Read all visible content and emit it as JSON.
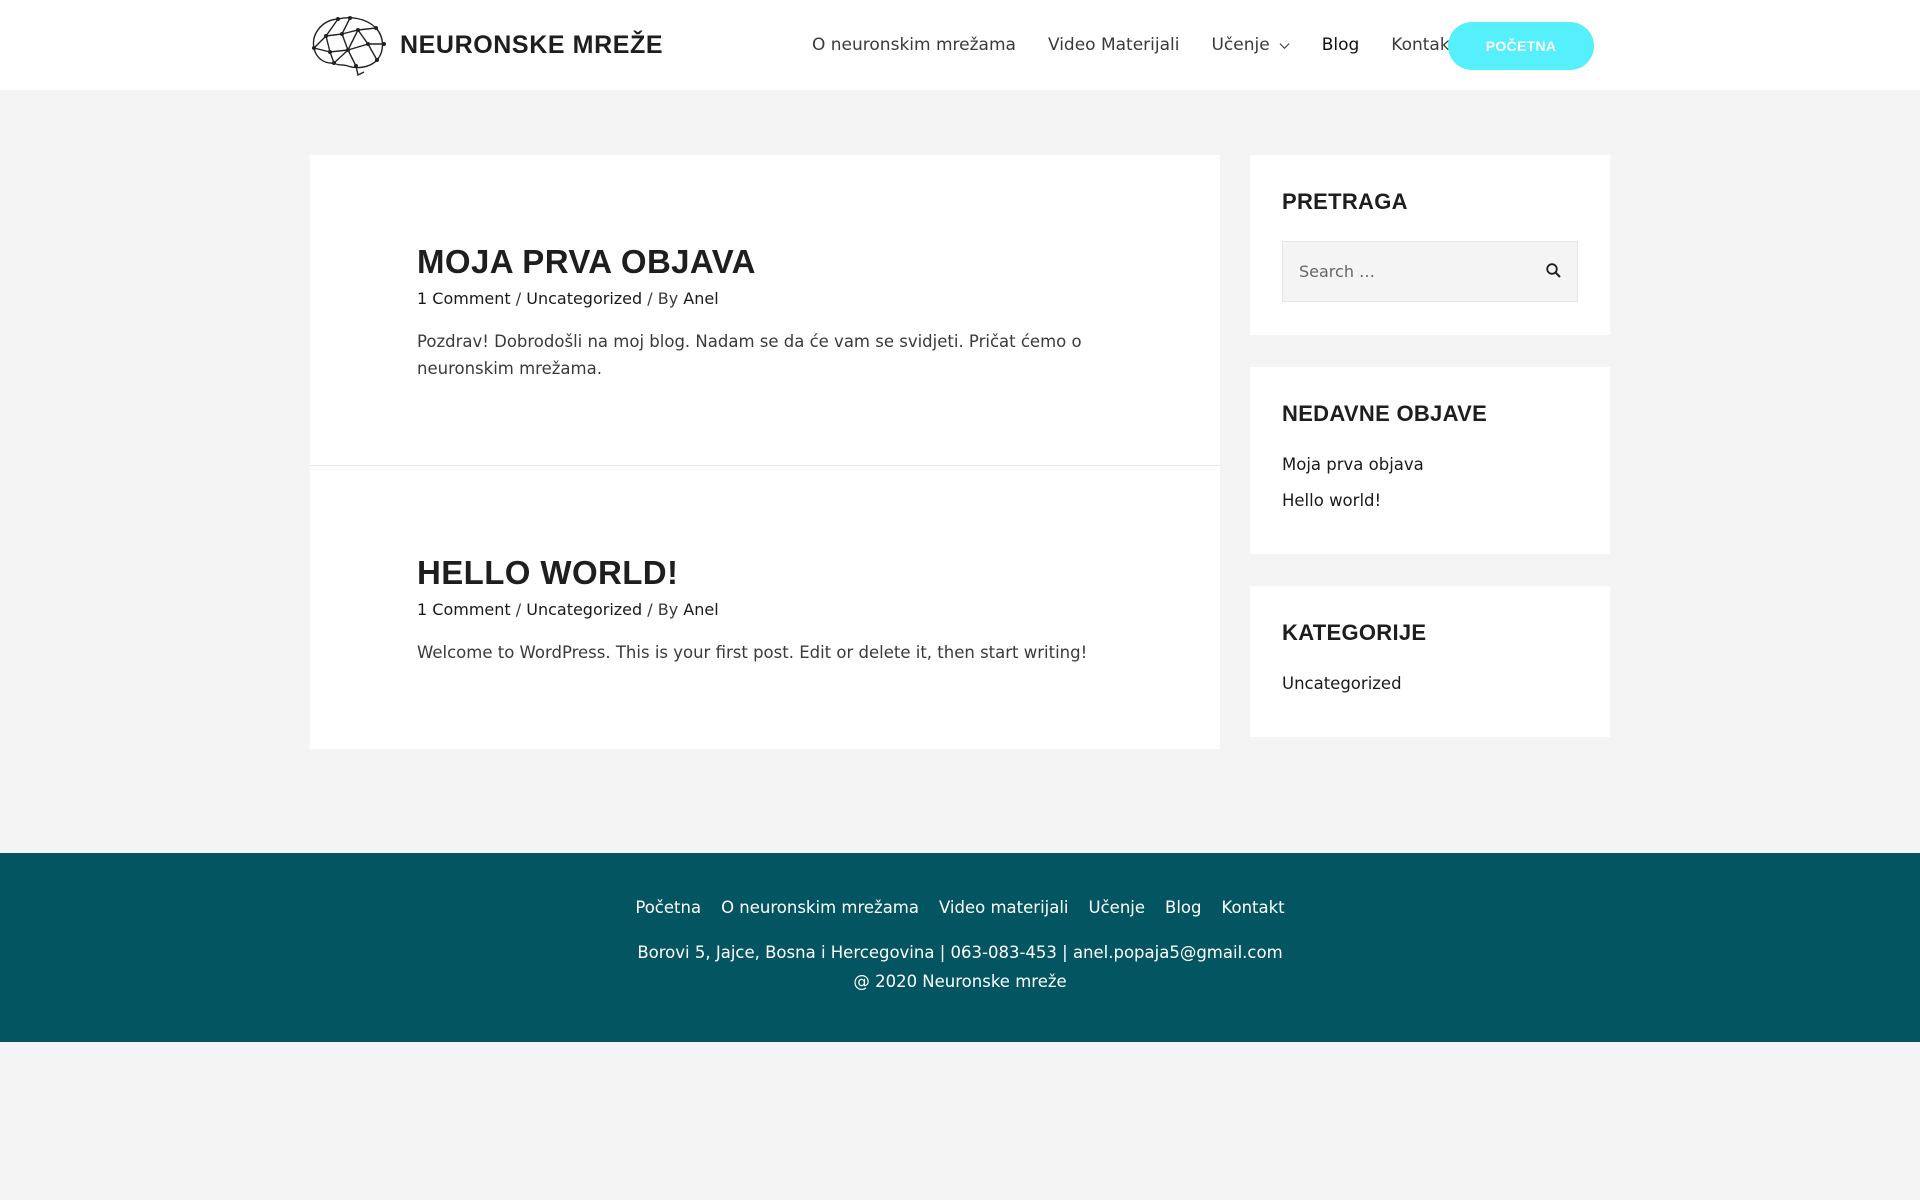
{
  "header": {
    "site_title": "NEURONSKE MREŽE",
    "logo_icon": "brain-network-icon",
    "nav": [
      {
        "label": "O neuronskim mrežama"
      },
      {
        "label": "Video Materijali"
      },
      {
        "label": "Učenje",
        "has_dropdown": true
      },
      {
        "label": "Blog",
        "current": true
      },
      {
        "label": "Kontakt"
      }
    ],
    "cta_label": "POČETNA"
  },
  "posts": [
    {
      "title": "MOJA PRVA OBJAVA",
      "comments": "1 Comment",
      "category": "Uncategorized",
      "by_prefix": "/ By",
      "author": "Anel",
      "excerpt": "Pozdrav! Dobrodošli na moj blog. Nadam se da će vam se svidjeti. Pričat ćemo o neuronskim mrežama."
    },
    {
      "title": "HELLO WORLD!",
      "comments": "1 Comment",
      "category": "Uncategorized",
      "by_prefix": "/ By",
      "author": "Anel",
      "excerpt": "Welcome to WordPress. This is your first post. Edit or delete it, then start writing!"
    }
  ],
  "meta_separator": "/",
  "sidebar": {
    "search": {
      "title": "PRETRAGA",
      "placeholder": "Search …"
    },
    "recent": {
      "title": "NEDAVNE OBJAVE",
      "items": [
        "Moja prva objava",
        "Hello world!"
      ]
    },
    "categories": {
      "title": "KATEGORIJE",
      "items": [
        "Uncategorized"
      ]
    }
  },
  "footer": {
    "nav": [
      "Početna",
      "O neuronskim mrežama",
      "Video materijali",
      "Učenje",
      "Blog",
      "Kontakt"
    ],
    "address": "Borovi 5, Jajce, Bosna i Hercegovina | 063-083-453 | anel.popaja5@gmail.com",
    "copyright": "@ 2020 Neuronske mreže"
  },
  "colors": {
    "accent_button": "#55f0fb",
    "footer_bg": "#035561",
    "page_bg": "#f4f4f4"
  }
}
